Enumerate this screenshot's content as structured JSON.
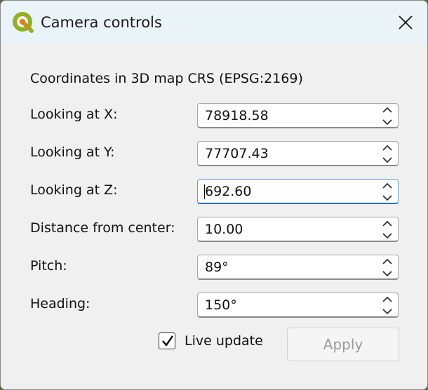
{
  "window": {
    "title": "Camera controls",
    "app_icon": "qgis-logo-icon",
    "close_icon": "close-icon"
  },
  "crs_label": "Coordinates in 3D map CRS (EPSG:2169)",
  "fields": [
    {
      "label": "Looking at X:",
      "value": "78918.58"
    },
    {
      "label": "Looking at Y:",
      "value": "77707.43"
    },
    {
      "label": "Looking at Z:",
      "value": "692.60"
    },
    {
      "label": "Distance from center:",
      "value": "10.00"
    },
    {
      "label": "Pitch:",
      "value": "89°"
    },
    {
      "label": "Heading:",
      "value": "150°"
    }
  ],
  "live_update": {
    "label": "Live update",
    "checked": true
  },
  "apply_label": "Apply",
  "colors": {
    "titlebar": "#e9f3f8",
    "focus_accent": "#1e6fd0",
    "disabled_text": "#9a9a9a"
  }
}
